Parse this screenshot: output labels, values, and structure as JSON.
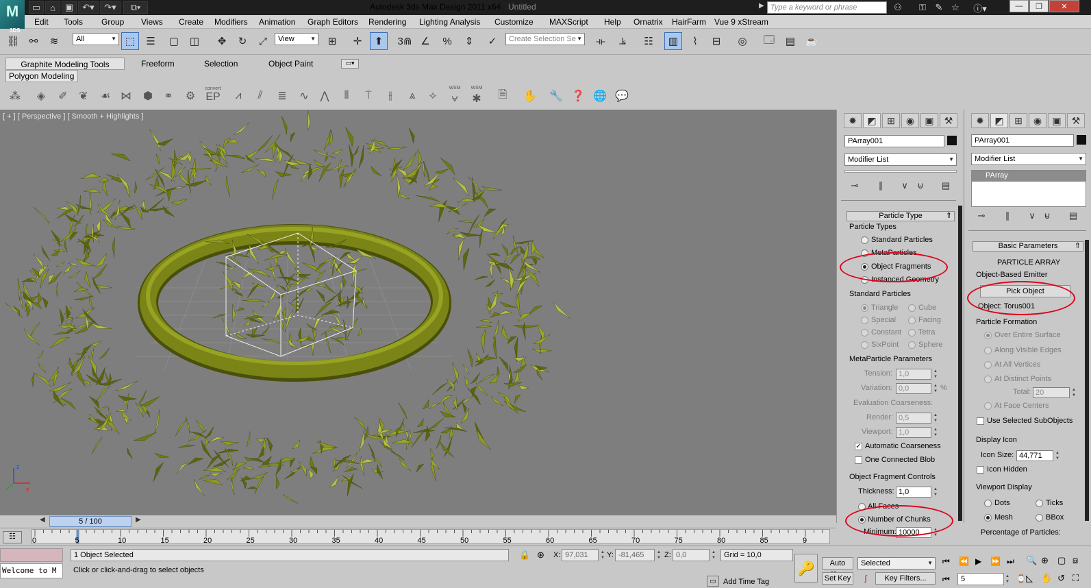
{
  "titlebar": {
    "title": "Autodesk 3ds Max Design 2011 x64",
    "document": "Untitled",
    "search_placeholder": "Type a keyword or phrase",
    "logo_text": "M",
    "logo_sub": "3DS"
  },
  "menu": [
    "Edit",
    "Tools",
    "Group",
    "Views",
    "Create",
    "Modifiers",
    "Animation",
    "Graph Editors",
    "Rendering",
    "Lighting Analysis",
    "Customize",
    "MAXScript",
    "Help",
    "Ornatrix",
    "HairFarm",
    "Vue 9 xStream"
  ],
  "toolbar": {
    "filter_value": "All",
    "coord_system": "View",
    "selection_set_placeholder": "Create Selection Se",
    "snap_3": "3"
  },
  "ribbon": {
    "tabs": [
      "Graphite Modeling Tools",
      "Freeform",
      "Selection",
      "Object Paint"
    ],
    "panel_label": "Polygon Modeling",
    "convert_label": "convert",
    "ep_label": "EP",
    "wsm_label": "WSM"
  },
  "viewport": {
    "label": "[ + ] [ Perspective ] [ Smooth + Highlights ]",
    "colors": {
      "background": "#7e7e7e",
      "particles": "#8e9a22",
      "torus": "#7b8416"
    }
  },
  "panel_left": {
    "object_name": "PArray001",
    "modifier_list": "Modifier List",
    "particle_type": {
      "header": "Particle Type",
      "types_label": "Particle Types",
      "types": [
        {
          "label": "Standard Particles",
          "on": false
        },
        {
          "label": "MetaParticles",
          "on": false
        },
        {
          "label": "Object Fragments",
          "on": true
        },
        {
          "label": "Instanced Geometry",
          "on": false
        }
      ],
      "standard_label": "Standard Particles",
      "standard": [
        "Triangle",
        "Cube",
        "Special",
        "Facing",
        "Constant",
        "Tetra",
        "SixPoint",
        "Sphere"
      ],
      "meta_label": "MetaParticle Parameters",
      "tension_label": "Tension:",
      "tension": "1,0",
      "variation_label": "Variation:",
      "variation": "0,0",
      "percent": "%",
      "eval_label": "Evaluation Coarseness:",
      "render_label": "Render:",
      "render": "0,5",
      "viewport_label": "Viewport:",
      "viewport": "1,0",
      "auto_coarse": "Automatic Coarseness",
      "one_blob": "One Connected Blob",
      "frag_label": "Object Fragment Controls",
      "thickness_label": "Thickness:",
      "thickness": "1,0",
      "all_faces": "All Faces",
      "num_chunks": "Number of Chunks",
      "minimum_label": "Minimum:",
      "minimum": "10000"
    }
  },
  "panel_right": {
    "object_name": "PArray001",
    "modifier_list": "Modifier List",
    "stack_item": "PArray",
    "basic_header": "Basic Parameters",
    "title": "PARTICLE ARRAY",
    "emitter_label": "Object-Based Emitter",
    "pick_object": "Pick Object",
    "object_label": "Object: Torus001",
    "formation_label": "Particle Formation",
    "formation": [
      "Over Entire Surface",
      "Along Visible Edges",
      "At All Vertices",
      "At Distinct Points",
      "At Face Centers"
    ],
    "total_label": "Total:",
    "total": "20",
    "use_sub": "Use Selected SubObjects",
    "display_icon": "Display Icon",
    "icon_size_label": "Icon Size:",
    "icon_size": "44,771",
    "icon_hidden": "Icon Hidden",
    "viewport_display": "Viewport Display",
    "vp_options": [
      "Dots",
      "Ticks",
      "Mesh",
      "BBox"
    ],
    "percentage": "Percentage of Particles:"
  },
  "timeline": {
    "frame_display": "5 / 100",
    "current_frame": 5,
    "total_frames": 100,
    "ticks": [
      "0",
      "5",
      "10",
      "15",
      "20",
      "25",
      "30",
      "35",
      "40",
      "45",
      "50",
      "55",
      "60",
      "65",
      "70",
      "75",
      "80",
      "85",
      "9"
    ]
  },
  "status": {
    "selected": "1 Object Selected",
    "prompt": "Click or click-and-drag to select objects",
    "welcome": "Welcome to M",
    "x_label": "X:",
    "x": "97,031",
    "y_label": "Y:",
    "y": "-81,465",
    "z_label": "Z:",
    "z": "0,0",
    "grid": "Grid = 10,0",
    "add_time_tag": "Add Time Tag",
    "auto_key": "Auto Key",
    "set_key": "Set Key",
    "selected_dropdown": "Selected",
    "key_filters": "Key Filters...",
    "frame_field": "5"
  }
}
